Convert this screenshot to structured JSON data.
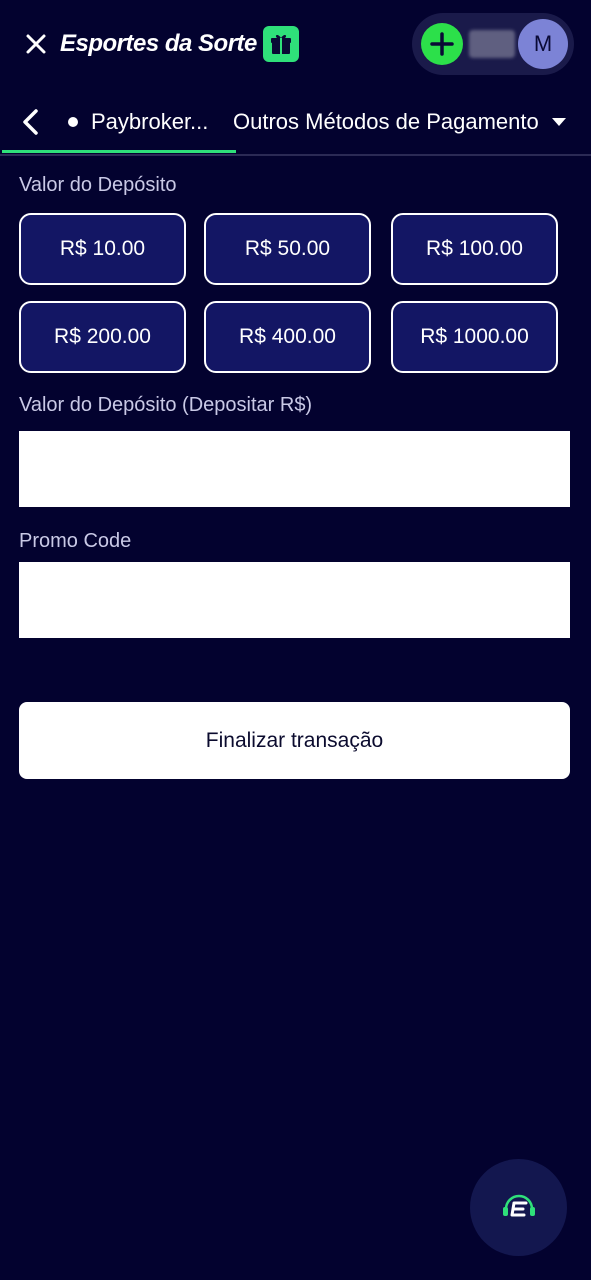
{
  "header": {
    "logo_text": "Esportes da Sorte",
    "logo_icon": "gift-icon",
    "avatar_initial": "M"
  },
  "tabs": {
    "items": [
      {
        "label": "Paybroker...",
        "active": true
      },
      {
        "label": "Outros Métodos de Pagamento",
        "active": false
      }
    ]
  },
  "deposit": {
    "section_label": "Valor do Depósito",
    "amounts": [
      "R$ 10.00",
      "R$ 50.00",
      "R$ 100.00",
      "R$ 200.00",
      "R$ 400.00",
      "R$ 1000.00"
    ],
    "amount_input_label": "Valor do Depósito (Depositar R$)",
    "amount_input_value": "",
    "promo_label": "Promo Code",
    "promo_value": "",
    "submit_label": "Finalizar transação"
  },
  "colors": {
    "background": "#03022f",
    "accent_green": "#2fe07a",
    "button_fill": "#131664",
    "avatar": "#7c83d6"
  }
}
